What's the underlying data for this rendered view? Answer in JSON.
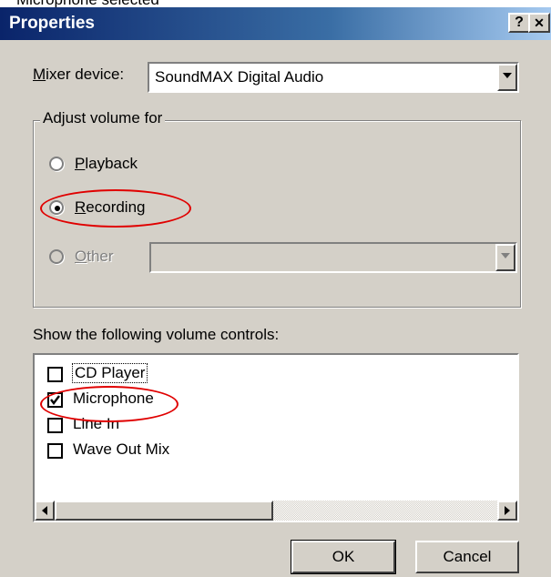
{
  "snippet_text": "Microphone selected",
  "window": {
    "title": "Properties",
    "help_label": "?",
    "close_label": "✕"
  },
  "mixer": {
    "label_prefix": "",
    "label_underlined": "M",
    "label_rest": "ixer device:",
    "selected_value": "SoundMAX Digital Audio"
  },
  "adjust": {
    "legend": "Adjust volume for",
    "options": [
      {
        "underlined": "P",
        "rest": "layback",
        "selected": false,
        "enabled": true
      },
      {
        "underlined": "R",
        "rest": "ecording",
        "selected": true,
        "enabled": true
      },
      {
        "underlined": "O",
        "rest": "ther",
        "selected": false,
        "enabled": false
      }
    ],
    "other_value": ""
  },
  "controls": {
    "heading": "Show the following volume controls:",
    "items": [
      {
        "label": "CD Player",
        "checked": false,
        "focused": true
      },
      {
        "label": "Microphone",
        "checked": true,
        "focused": false
      },
      {
        "label": "Line In",
        "checked": false,
        "focused": false
      },
      {
        "label": "Wave Out Mix",
        "checked": false,
        "focused": false
      }
    ]
  },
  "buttons": {
    "ok_label": "OK",
    "cancel_label": "Cancel"
  },
  "colors": {
    "title_gradient_start": "#0a246a",
    "title_gradient_end": "#a6caf0",
    "dialog_bg": "#d4d0c8",
    "annotation": "#e00000"
  },
  "icons": {
    "dropdown": "chevron-down-icon",
    "scroll_left": "arrow-left-icon",
    "scroll_right": "arrow-right-icon",
    "check": "check-icon"
  }
}
